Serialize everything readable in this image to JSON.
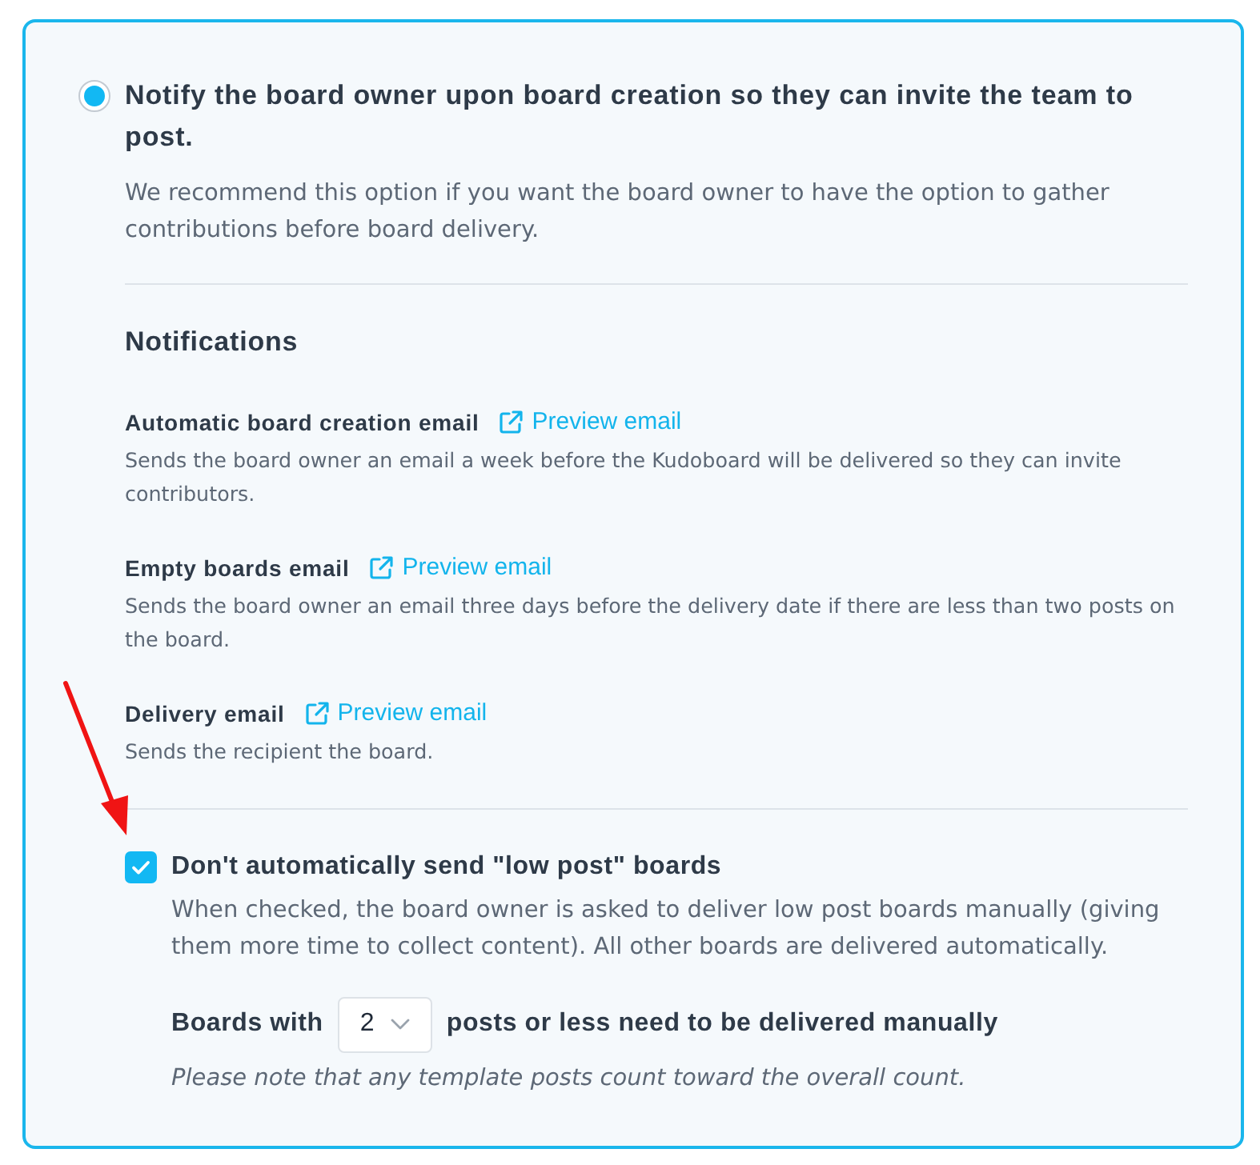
{
  "option": {
    "selected": true,
    "label": "Notify the board owner upon board creation so they can invite the team to post.",
    "description": "We recommend this option if you want the board owner to have the option to gather contributions before board delivery."
  },
  "notifications": {
    "heading": "Notifications",
    "items": [
      {
        "title": "Automatic board creation email",
        "link": "Preview email",
        "description": "Sends the board owner an email a week before the Kudoboard will be delivered so they can invite contributors."
      },
      {
        "title": "Empty boards email",
        "link": "Preview email",
        "description": "Sends the board owner an email three days before the delivery date if there are less than two posts on the board."
      },
      {
        "title": "Delivery email",
        "link": "Preview email",
        "description": "Sends the recipient the board."
      }
    ]
  },
  "low_post": {
    "checked": true,
    "label": "Don't automatically send \"low post\" boards",
    "description": "When checked, the board owner is asked to deliver low post boards manually (giving them more time to collect content). All other boards are delivered automatically.",
    "threshold": {
      "prefix": "Boards with",
      "value": "2",
      "suffix": "posts or less need to be delivered manually"
    },
    "note": "Please note that any template posts count toward the overall count."
  }
}
